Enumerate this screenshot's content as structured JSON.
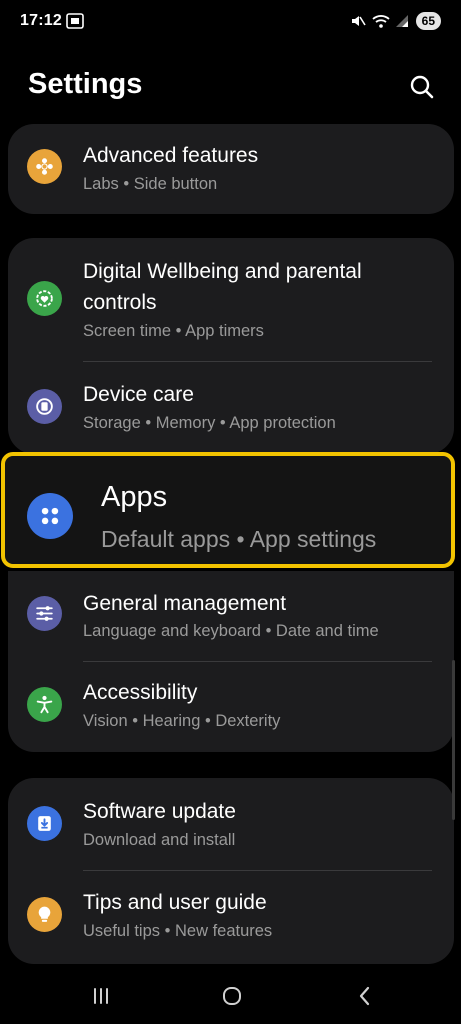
{
  "status_bar": {
    "time": "17:12",
    "battery": "65",
    "icons": [
      "screenshot-icon",
      "mute-icon",
      "wifi-icon",
      "signal-icon",
      "battery-icon"
    ]
  },
  "header": {
    "title": "Settings",
    "search_icon": "search-icon"
  },
  "items": {
    "advanced": {
      "title": "Advanced features",
      "subtitle": "Labs  •  Side button",
      "icon": "gear-flower-icon",
      "color": "#e8a43a"
    },
    "wellbeing": {
      "title_line1": "Digital Wellbeing and parental",
      "title_line2": "controls",
      "subtitle": "Screen time  •  App timers",
      "icon": "wellbeing-icon",
      "color": "#3aa54a"
    },
    "device_care": {
      "title": "Device care",
      "subtitle": "Storage  •  Memory  •  App protection",
      "icon": "device-care-icon",
      "color": "#5b5ea6"
    },
    "apps": {
      "title": "Apps",
      "subtitle": "Default apps  •  App settings",
      "icon": "apps-grid-icon",
      "color": "#3b72e0"
    },
    "general": {
      "title": "General management",
      "subtitle": "Language and keyboard  •  Date and time",
      "icon": "sliders-icon",
      "color": "#5b5ea6"
    },
    "accessibility": {
      "title": "Accessibility",
      "subtitle": "Vision  •  Hearing  •  Dexterity",
      "icon": "accessibility-icon",
      "color": "#3aa54a"
    },
    "software": {
      "title": "Software update",
      "subtitle": "Download and install",
      "icon": "download-icon",
      "color": "#3b72e0"
    },
    "tips": {
      "title": "Tips and user guide",
      "subtitle": "Useful tips  •  New features",
      "icon": "lightbulb-icon",
      "color": "#e8a43a"
    }
  },
  "highlight_color": "#f2c300",
  "nav": [
    "recents-icon",
    "home-icon",
    "back-icon"
  ]
}
